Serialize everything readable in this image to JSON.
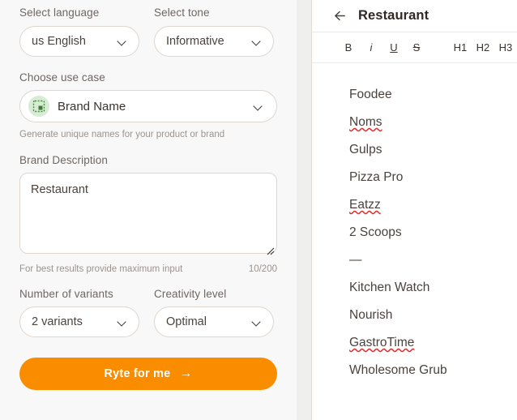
{
  "left": {
    "fields": {
      "language": {
        "label": "Select language",
        "value": "us English"
      },
      "tone": {
        "label": "Select tone",
        "value": "Informative"
      },
      "usecase": {
        "label": "Choose use case",
        "value": "Brand Name",
        "icon": "brand-name-icon",
        "helper": "Generate unique names for your product or brand"
      },
      "description": {
        "label": "Brand Description",
        "value": "Restaurant",
        "placeholder": "",
        "helper": "For best results provide maximum input",
        "counter": "10/200"
      },
      "variants": {
        "label": "Number of variants",
        "value": "2 variants"
      },
      "creativity": {
        "label": "Creativity level",
        "value": "Optimal"
      }
    },
    "cta": {
      "label": "Ryte for me",
      "arrow": "→"
    }
  },
  "right": {
    "header": {
      "back_icon": "arrow-left-icon",
      "title": "Restaurant"
    },
    "toolbar": [
      {
        "name": "bold",
        "label": "B"
      },
      {
        "name": "italic",
        "label": "i"
      },
      {
        "name": "underline",
        "label": "U"
      },
      {
        "name": "strikethrough",
        "label": "S"
      },
      {
        "name": "heading-1",
        "label": "H1"
      },
      {
        "name": "heading-2",
        "label": "H2"
      },
      {
        "name": "heading-3",
        "label": "H3"
      }
    ],
    "document_lines": [
      {
        "text": "Foodee",
        "misspelled": false
      },
      {
        "text": "Noms",
        "misspelled": true
      },
      {
        "text": "Gulps",
        "misspelled": false
      },
      {
        "text": "Pizza Pro",
        "misspelled": false
      },
      {
        "text": "Eatzz",
        "misspelled": true
      },
      {
        "text": "2 Scoops",
        "misspelled": false
      },
      {
        "text": "—",
        "misspelled": false
      },
      {
        "text": "Kitchen Watch",
        "misspelled": false
      },
      {
        "text": "Nourish",
        "misspelled": false
      },
      {
        "text": "GastroTime",
        "misspelled": true
      },
      {
        "text": "Wholesome Grub",
        "misspelled": false
      }
    ]
  },
  "colors": {
    "accent_orange": "#fa8c00",
    "panel_bg": "#f9f8f8",
    "border": "#ded6cf",
    "label_text": "#6e6661",
    "value_text": "#4a423d",
    "spellcheck_red": "#e03030",
    "usecase_icon_bg": "#d6ecd3"
  }
}
